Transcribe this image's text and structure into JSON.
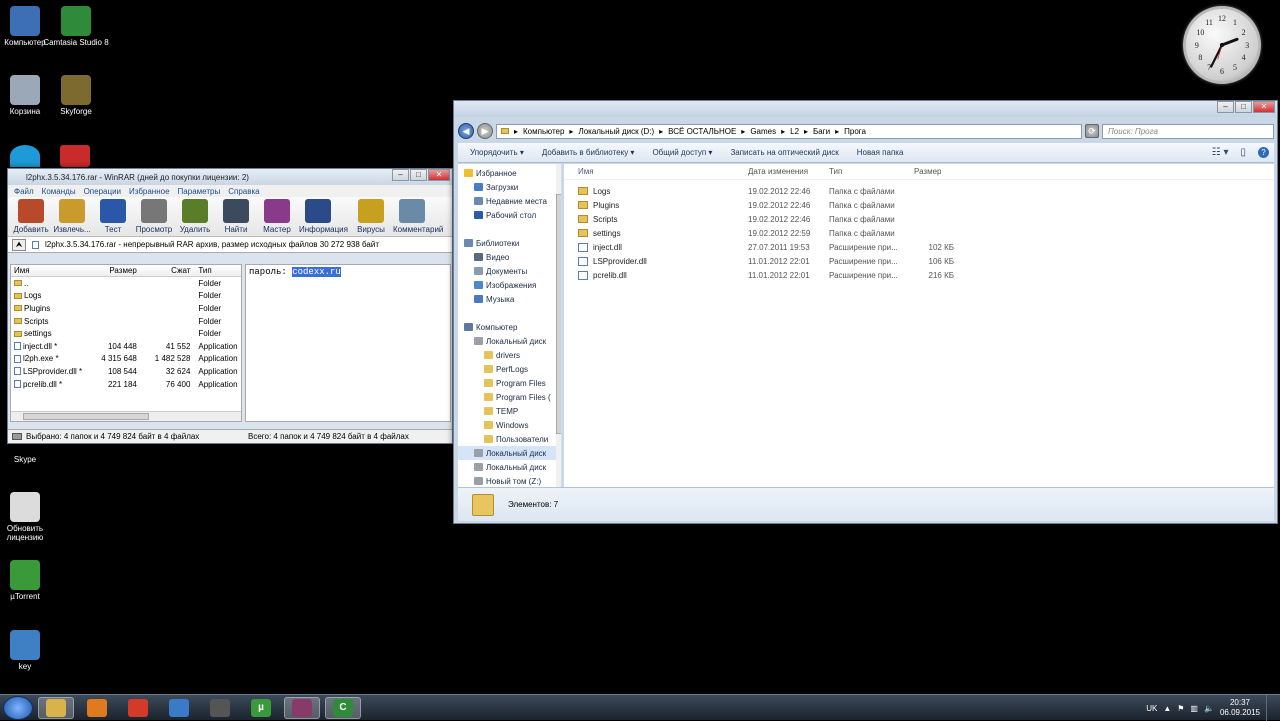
{
  "desktop_icons": [
    {
      "label": "Компьютер",
      "icon": "computer-icon",
      "color": "#3d6fb5"
    },
    {
      "label": "Camtasia Studio 8",
      "icon": "camtasia-icon",
      "color": "#2f8a3a"
    },
    {
      "label": "Корзина",
      "icon": "recycle-bin-icon",
      "color": "#9aa8b8"
    },
    {
      "label": "Skyforge",
      "icon": "skyforge-icon",
      "color": "#7c6a2e"
    },
    {
      "label": "Skype",
      "icon": "skype-icon",
      "color": "#1e9ad6"
    },
    {
      "label": "Обновить лицензию",
      "icon": "update-icon",
      "color": "#dcdcdc"
    },
    {
      "label": "µTorrent",
      "icon": "utorrent-icon",
      "color": "#3a9a3a"
    },
    {
      "label": "key",
      "icon": "key-globe-icon",
      "color": "#3f7fc4"
    }
  ],
  "winrar": {
    "title": "l2phx.3.5.34.176.rar - WinRAR (дней до покупки лицензии: 2)",
    "menu": [
      "Файл",
      "Команды",
      "Операции",
      "Избранное",
      "Параметры",
      "Справка"
    ],
    "toolbar": [
      {
        "label": "Добавить",
        "color": "#b84a2a"
      },
      {
        "label": "Извлечь...",
        "color": "#c99b2d"
      },
      {
        "label": "Тест",
        "color": "#2b57a8"
      },
      {
        "label": "Просмотр",
        "color": "#777"
      },
      {
        "label": "Удалить",
        "color": "#5a7d2a"
      },
      {
        "label": "Найти",
        "color": "#3b4a5c"
      },
      {
        "label": "Мастер",
        "color": "#8a3a8a"
      },
      {
        "label": "Информация",
        "color": "#2a4a8a"
      },
      {
        "label": "Вирусы",
        "color": "#c8a020"
      },
      {
        "label": "Комментарий",
        "color": "#6a8aa8"
      }
    ],
    "path": "l2phx.3.5.34.176.rar - непрерывный RAR архив, размер исходных файлов 30 272 938 байт",
    "columns": {
      "name": "Имя",
      "size": "Размер",
      "packed": "Сжат",
      "type": "Тип"
    },
    "files": [
      {
        "name": "..",
        "size": "",
        "packed": "",
        "type": "Folder",
        "kind": "folder"
      },
      {
        "name": "Logs",
        "size": "",
        "packed": "",
        "type": "Folder",
        "kind": "folder"
      },
      {
        "name": "Plugins",
        "size": "",
        "packed": "",
        "type": "Folder",
        "kind": "folder"
      },
      {
        "name": "Scripts",
        "size": "",
        "packed": "",
        "type": "Folder",
        "kind": "folder"
      },
      {
        "name": "settings",
        "size": "",
        "packed": "",
        "type": "Folder",
        "kind": "folder"
      },
      {
        "name": "inject.dll *",
        "size": "104 448",
        "packed": "41 552",
        "type": "Application",
        "kind": "file"
      },
      {
        "name": "l2ph.exe *",
        "size": "4 315 648",
        "packed": "1 482 528",
        "type": "Application",
        "kind": "file"
      },
      {
        "name": "LSPprovider.dll *",
        "size": "108 544",
        "packed": "32 624",
        "type": "Application",
        "kind": "file"
      },
      {
        "name": "pcrelib.dll *",
        "size": "221 184",
        "packed": "76 400",
        "type": "Application",
        "kind": "file"
      }
    ],
    "comment_label": "пароль:",
    "comment_value": "codexx.ru",
    "status_selected": "Выбрано: 4 папок и 4 749 824 байт в 4 файлах",
    "status_total": "Всего: 4 папок и 4 749 824 байт в 4 файлах"
  },
  "explorer": {
    "breadcrumbs": [
      "Компьютер",
      "Локальный диск (D:)",
      "ВСЁ ОСТАЛЬНОЕ",
      "Games",
      "L2",
      "Баги",
      "Прога"
    ],
    "search_placeholder": "Поиск: Прога",
    "commands": [
      "Упорядочить ▾",
      "Добавить в библиотеку ▾",
      "Общий доступ ▾",
      "Записать на оптический диск",
      "Новая папка"
    ],
    "nav": [
      {
        "label": "Избранное",
        "indent": 0,
        "icon": "star-icon"
      },
      {
        "label": "Загрузки",
        "indent": 1,
        "icon": "downloads-icon"
      },
      {
        "label": "Недавние места",
        "indent": 1,
        "icon": "recent-icon"
      },
      {
        "label": "Рабочий стол",
        "indent": 1,
        "icon": "desktop-icon"
      },
      {
        "label": "",
        "indent": 0,
        "icon": "spacer"
      },
      {
        "label": "Библиотеки",
        "indent": 0,
        "icon": "library-icon"
      },
      {
        "label": "Видео",
        "indent": 1,
        "icon": "video-icon"
      },
      {
        "label": "Документы",
        "indent": 1,
        "icon": "documents-icon"
      },
      {
        "label": "Изображения",
        "indent": 1,
        "icon": "pictures-icon"
      },
      {
        "label": "Музыка",
        "indent": 1,
        "icon": "music-icon"
      },
      {
        "label": "",
        "indent": 0,
        "icon": "spacer"
      },
      {
        "label": "Компьютер",
        "indent": 0,
        "icon": "computer-icon"
      },
      {
        "label": "Локальный диск",
        "indent": 1,
        "icon": "drive-icon"
      },
      {
        "label": "drivers",
        "indent": 2,
        "icon": "folder-icon"
      },
      {
        "label": "PerfLogs",
        "indent": 2,
        "icon": "folder-icon"
      },
      {
        "label": "Program Files",
        "indent": 2,
        "icon": "folder-icon"
      },
      {
        "label": "Program Files (",
        "indent": 2,
        "icon": "folder-icon"
      },
      {
        "label": "TEMP",
        "indent": 2,
        "icon": "folder-icon"
      },
      {
        "label": "Windows",
        "indent": 2,
        "icon": "folder-icon"
      },
      {
        "label": "Пользователи",
        "indent": 2,
        "icon": "folder-icon"
      },
      {
        "label": "Локальный диск",
        "indent": 1,
        "icon": "drive-icon",
        "selected": true
      },
      {
        "label": "Локальный диск",
        "indent": 1,
        "icon": "drive-icon"
      },
      {
        "label": "Новый том (Z:)",
        "indent": 1,
        "icon": "drive-icon"
      }
    ],
    "columns": {
      "name": "Имя",
      "date": "Дата изменения",
      "type": "Тип",
      "size": "Размер"
    },
    "files": [
      {
        "name": "Logs",
        "date": "19.02.2012 22:46",
        "type": "Папка с файлами",
        "size": "",
        "kind": "folder"
      },
      {
        "name": "Plugins",
        "date": "19.02.2012 22:46",
        "type": "Папка с файлами",
        "size": "",
        "kind": "folder"
      },
      {
        "name": "Scripts",
        "date": "19.02.2012 22:46",
        "type": "Папка с файлами",
        "size": "",
        "kind": "folder"
      },
      {
        "name": "settings",
        "date": "19.02.2012 22:59",
        "type": "Папка с файлами",
        "size": "",
        "kind": "folder"
      },
      {
        "name": "inject.dll",
        "date": "27.07.2011 19:53",
        "type": "Расширение при...",
        "size": "102 КБ",
        "kind": "file"
      },
      {
        "name": "LSPprovider.dll",
        "date": "11.01.2012 22:01",
        "type": "Расширение при...",
        "size": "106 КБ",
        "kind": "file"
      },
      {
        "name": "pcrelib.dll",
        "date": "11.01.2012 22:01",
        "type": "Расширение при...",
        "size": "216 КБ",
        "kind": "file"
      }
    ],
    "item_count": "Элементов: 7"
  },
  "taskbar": {
    "apps": [
      {
        "icon": "explorer-icon",
        "color": "#d9b24a",
        "active": true
      },
      {
        "icon": "media-player-icon",
        "color": "#e07a1f"
      },
      {
        "icon": "chrome-icon",
        "color": "#d43a2a"
      },
      {
        "icon": "cube-app-icon",
        "color": "#3a7ac8"
      },
      {
        "icon": "tank-game-icon",
        "color": "#555"
      },
      {
        "icon": "utorrent-icon",
        "color": "#3a9a3a",
        "glyph": "µ"
      },
      {
        "icon": "winrar-icon",
        "color": "#8a3a6a",
        "active": true
      },
      {
        "icon": "camtasia-icon",
        "color": "#2f8a3a",
        "glyph": "C",
        "active": true
      }
    ],
    "lang": "UK",
    "time": "20:37",
    "date": "06.09.2015"
  }
}
